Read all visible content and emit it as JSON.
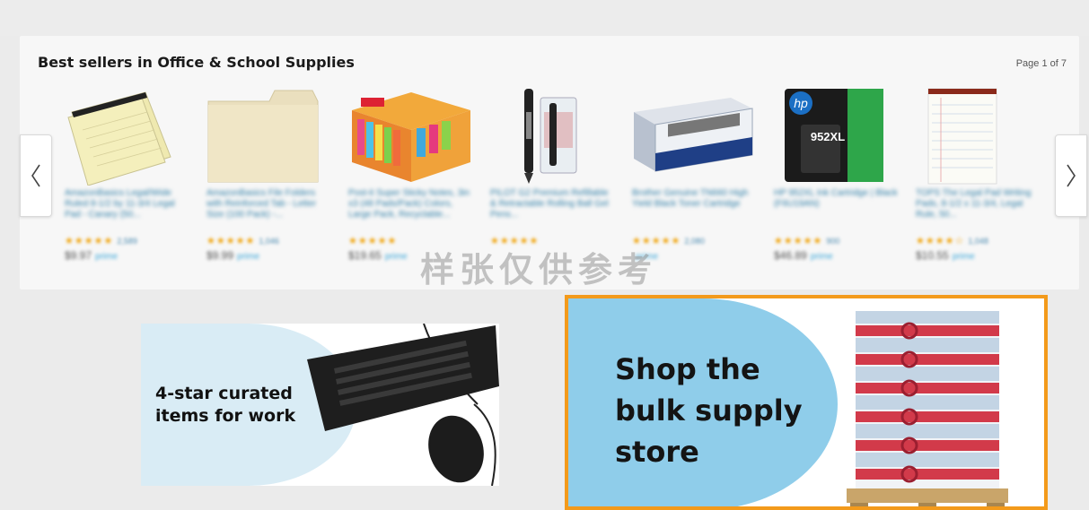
{
  "carousel": {
    "title": "Best sellers in Office & School Supplies",
    "page_indicator": "Page 1 of 7",
    "products": [
      {
        "desc": "AmazonBasics Legal/Wide Ruled 8-1/2 by 11-3/4 Legal Pad - Canary (50...",
        "stars": "★★★★★",
        "reviews": "2,589",
        "price": "$9.97",
        "prime": "prime",
        "icon": "legal-pad-icon"
      },
      {
        "desc": "AmazonBasics File Folders with Reinforced Tab - Letter Size (100 Pack) -...",
        "stars": "★★★★★",
        "reviews": "1,046",
        "price": "$9.99",
        "prime": "prime",
        "icon": "file-folder-icon"
      },
      {
        "desc": "Post-it Super Sticky Notes, 3in x3 (48 Pads/Pack) Colors, Large Pack, Recyclable...",
        "stars": "★★★★★",
        "reviews": "",
        "price": "$19.65",
        "prime": "prime",
        "icon": "sticky-notes-icon"
      },
      {
        "desc": "PILOT G2 Premium Refillable & Retractable Rolling Ball Gel Pens...",
        "stars": "★★★★★",
        "reviews": "",
        "price": "",
        "prime": "",
        "icon": "gel-pen-icon"
      },
      {
        "desc": "Brother Genuine TN660 High Yield Black Toner Cartridge",
        "stars": "★★★★★",
        "reviews": "2,080",
        "price": "",
        "prime": "prime",
        "icon": "toner-cartridge-icon"
      },
      {
        "desc": "HP 952XL Ink Cartridge | Black (F6U19AN)",
        "stars": "★★★★★",
        "reviews": "900",
        "price": "$46.89",
        "prime": "prime",
        "icon": "ink-cartridge-icon"
      },
      {
        "desc": "TOPS The Legal Pad Writing Pads, 8-1/2 x 11-3/4, Legal Rule, 50...",
        "stars": "★★★★☆",
        "reviews": "1,048",
        "price": "$10.55",
        "prime": "prime",
        "icon": "writing-pad-icon"
      }
    ]
  },
  "hp_label": "hp",
  "hp_model": "952XL",
  "watermark": "样张仅供参考",
  "banner_left": {
    "line1": "4-star curated",
    "line2": "items for work"
  },
  "banner_right": {
    "line1": "Shop the",
    "line2": "bulk supply",
    "line3": "store"
  },
  "colors": {
    "highlight_border": "#f39a1b",
    "bulk_bg": "#8fcdea",
    "curated_bg": "#d9ecf5"
  }
}
